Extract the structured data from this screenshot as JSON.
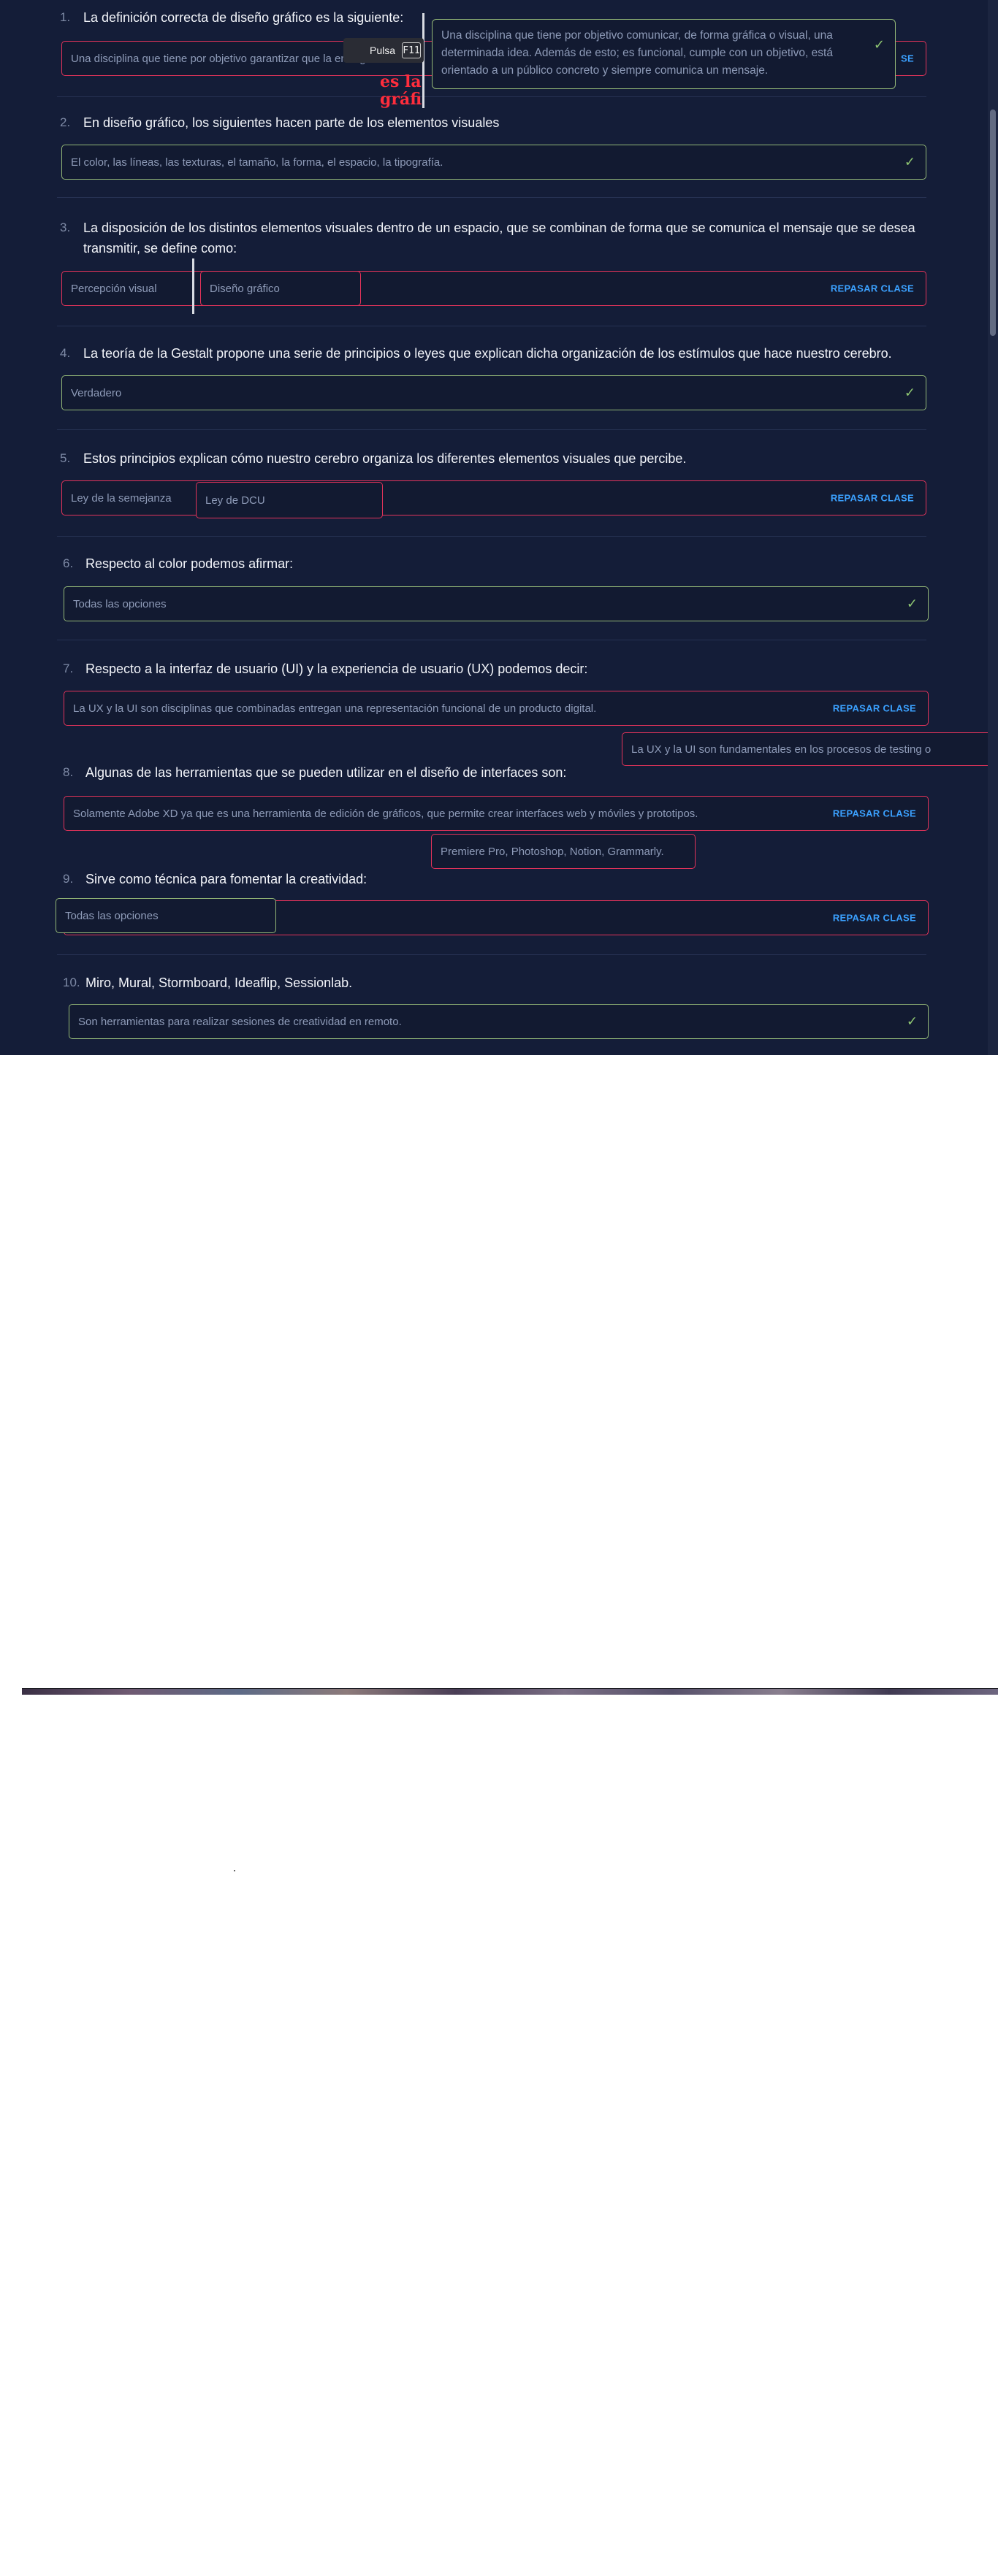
{
  "questions": [
    {
      "num": "1.",
      "text": "La definición correcta de diseño gráfico es la siguiente:",
      "answer": "Una disciplina que tiene por objetivo garantizar que la entrega",
      "review": "SE"
    },
    {
      "num": "2.",
      "text": "En diseño gráfico, los siguientes hacen parte de los elementos visuales",
      "answer": "El color, las líneas, las texturas, el tamaño, la forma, el espacio, la tipografía."
    },
    {
      "num": "3.",
      "text": "La disposición de los distintos elementos visuales dentro de un espacio, que se combinan de forma que se comunica el mensaje que se desea transmitir, se define como:",
      "answer": "Percepción visual",
      "drag": "Diseño gráfico",
      "review": "REPASAR CLASE"
    },
    {
      "num": "4.",
      "text": "La teoría de la Gestalt propone una serie de principios o leyes que explican dicha organización de los estímulos que hace nuestro cerebro.",
      "answer": "Verdadero"
    },
    {
      "num": "5.",
      "text": "Estos principios explican cómo nuestro cerebro organiza los diferentes elementos visuales que percibe.",
      "answer": "Ley de la semejanza",
      "drag": "Ley de DCU",
      "review": "REPASAR CLASE"
    },
    {
      "num": "6.",
      "text": "Respecto al color podemos afirmar:",
      "answer": "Todas las opciones"
    },
    {
      "num": "7.",
      "text": "Respecto a la interfaz de usuario (UI) y la experiencia de usuario (UX) podemos decir:",
      "answer": "La UX y la UI son disciplinas que combinadas entregan una representación funcional de un producto digital.",
      "drag": "La UX y la UI son fundamentales en los procesos de testing o",
      "review": "REPASAR CLASE"
    },
    {
      "num": "8.",
      "text": "Algunas de las herramientas que se pueden utilizar en el diseño de interfaces son:",
      "answer": "Solamente Adobe XD ya que es una herramienta de edición de gráficos, que permite crear interfaces web y móviles y prototipos.",
      "drag": "Premiere Pro, Photoshop, Notion, Grammarly.",
      "review": "REPASAR CLASE"
    },
    {
      "num": "9.",
      "text": "Sirve como técnica para fomentar la creatividad:",
      "answer": "Todas las opciones",
      "review": "REPASAR CLASE"
    },
    {
      "num": "10.",
      "text": "Miro, Mural, Stormboard, Ideaflip, Sessionlab.",
      "answer": "Son herramientas para realizar sesiones de creatividad en remoto."
    }
  ],
  "popup": {
    "text": "Una disciplina que tiene por objetivo comunicar, de forma gráfica o visual, una determinada idea. Además de esto; es funcional, cumple con un objetivo, está orientado a un público concreto y siempre comunica un mensaje."
  },
  "key_hint": {
    "press": "Pulsa",
    "key": "F11"
  },
  "overlay_red_text": "es la gráfi",
  "colors": {
    "background": "#141d38",
    "correct": "#93b777",
    "wrong": "#e2335a",
    "link": "#3ba1ff",
    "check": "#8fc772"
  }
}
